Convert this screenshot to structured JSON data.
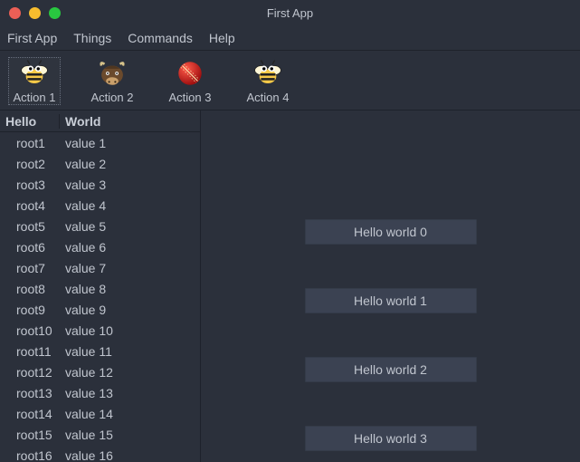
{
  "window": {
    "title": "First App"
  },
  "menubar": {
    "items": [
      {
        "label": "First App"
      },
      {
        "label": "Things"
      },
      {
        "label": "Commands"
      },
      {
        "label": "Help"
      }
    ]
  },
  "toolbar": {
    "actions": [
      {
        "label": "Action 1",
        "icon": "bee-icon",
        "selected": true
      },
      {
        "label": "Action 2",
        "icon": "yak-icon",
        "selected": false
      },
      {
        "label": "Action 3",
        "icon": "cricket-ball-icon",
        "selected": false
      },
      {
        "label": "Action 4",
        "icon": "bee-icon",
        "selected": false
      }
    ]
  },
  "list": {
    "columns": [
      {
        "label": "Hello"
      },
      {
        "label": "World"
      }
    ],
    "rows": [
      {
        "c1": "root1",
        "c2": "value 1"
      },
      {
        "c1": "root2",
        "c2": "value 2"
      },
      {
        "c1": "root3",
        "c2": "value 3"
      },
      {
        "c1": "root4",
        "c2": "value 4"
      },
      {
        "c1": "root5",
        "c2": "value 5"
      },
      {
        "c1": "root6",
        "c2": "value 6"
      },
      {
        "c1": "root7",
        "c2": "value 7"
      },
      {
        "c1": "root8",
        "c2": "value 8"
      },
      {
        "c1": "root9",
        "c2": "value 9"
      },
      {
        "c1": "root10",
        "c2": "value 10"
      },
      {
        "c1": "root11",
        "c2": "value 11"
      },
      {
        "c1": "root12",
        "c2": "value 12"
      },
      {
        "c1": "root13",
        "c2": "value 13"
      },
      {
        "c1": "root14",
        "c2": "value 14"
      },
      {
        "c1": "root15",
        "c2": "value 15"
      },
      {
        "c1": "root16",
        "c2": "value 16"
      }
    ]
  },
  "right": {
    "buttons": [
      {
        "label": "Hello world 0"
      },
      {
        "label": "Hello world 1"
      },
      {
        "label": "Hello world 2"
      },
      {
        "label": "Hello world 3"
      }
    ]
  }
}
